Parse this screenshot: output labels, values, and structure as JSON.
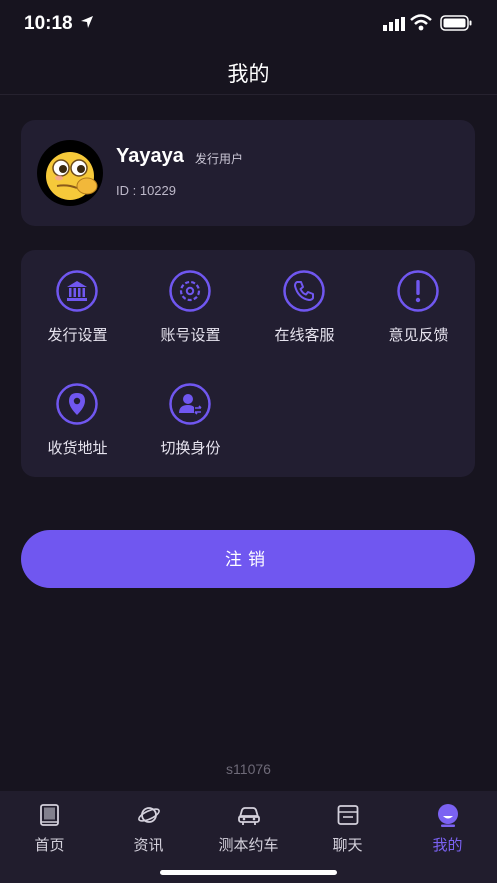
{
  "status": {
    "time": "10:18"
  },
  "header": {
    "title": "我的"
  },
  "profile": {
    "name": "Yayaya",
    "tag": "发行用户",
    "id_text": "ID : 10229"
  },
  "menu": {
    "items": [
      {
        "label": "发行设置",
        "icon": "bank-icon"
      },
      {
        "label": "账号设置",
        "icon": "gear-icon"
      },
      {
        "label": "在线客服",
        "icon": "phone-icon"
      },
      {
        "label": "意见反馈",
        "icon": "exclamation-icon"
      },
      {
        "label": "收货地址",
        "icon": "location-pin-icon"
      },
      {
        "label": "切换身份",
        "icon": "switch-user-icon"
      }
    ]
  },
  "logout_label": "注销",
  "version": "s11076",
  "tabs": [
    {
      "label": "首页",
      "icon": "book-icon",
      "active": false
    },
    {
      "label": "资讯",
      "icon": "planet-icon",
      "active": false
    },
    {
      "label": "测本约车",
      "icon": "car-icon",
      "active": false
    },
    {
      "label": "聊天",
      "icon": "chat-box-icon",
      "active": false
    },
    {
      "label": "我的",
      "icon": "profile-icon",
      "active": true
    }
  ],
  "colors": {
    "background": "#17141f",
    "card": "#221e31",
    "accent": "#7057f0",
    "active_tab": "#7b62f2"
  }
}
